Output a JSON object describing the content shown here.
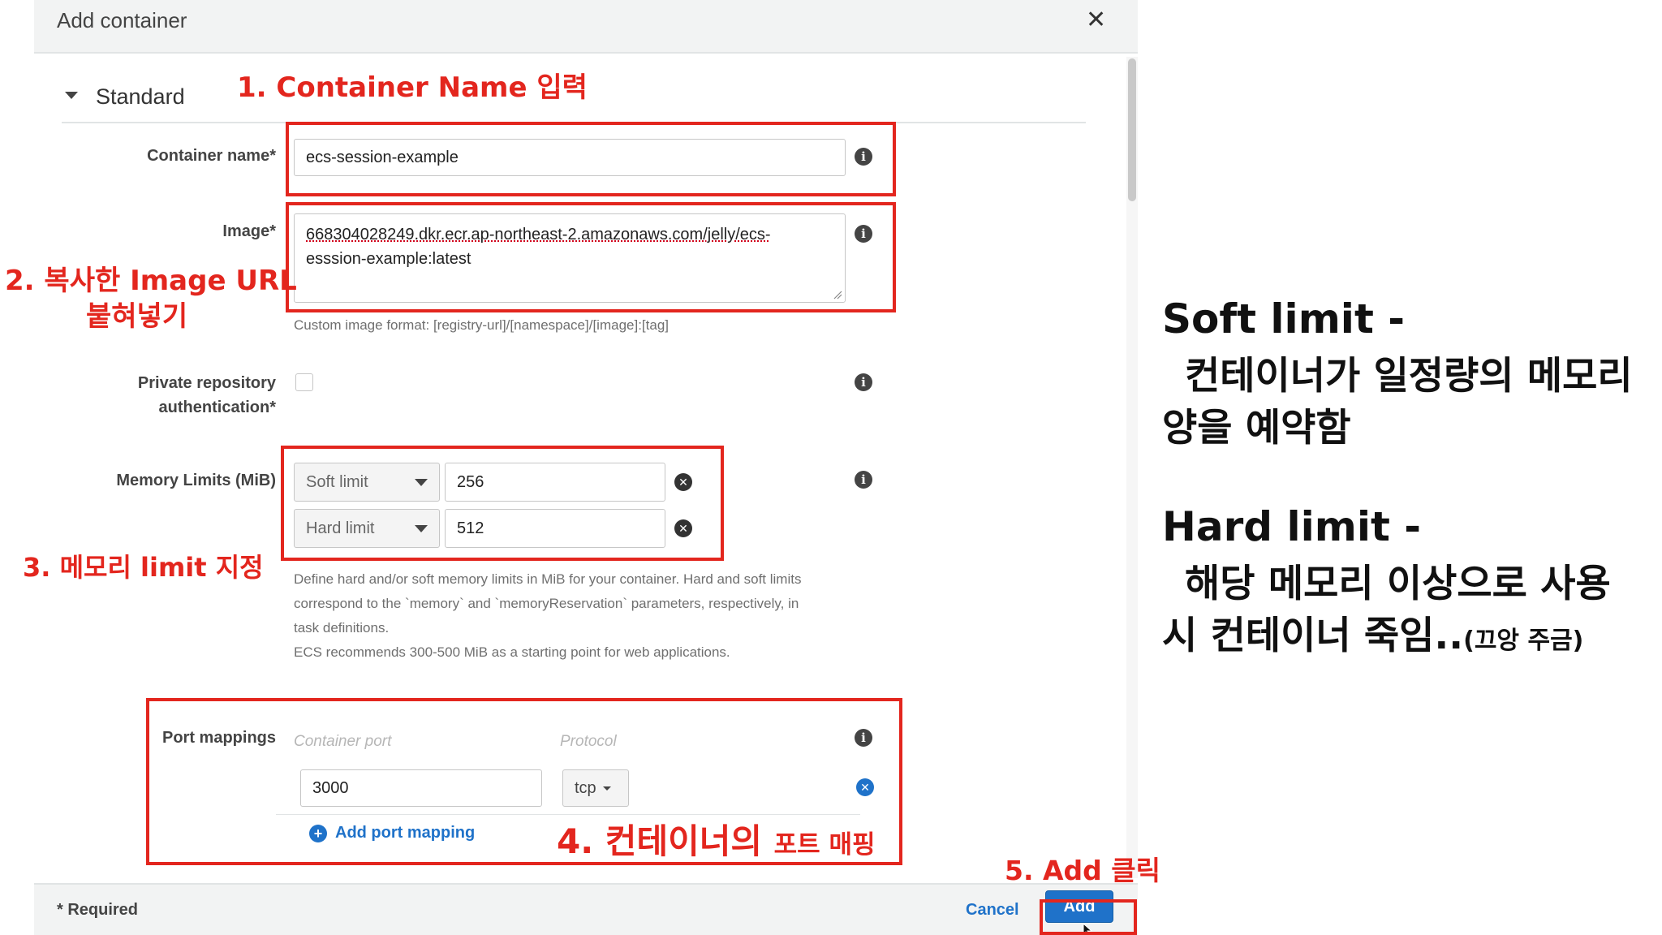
{
  "modal": {
    "title": "Add container",
    "section": "Standard",
    "container_name": {
      "label": "Container name*",
      "value": "ecs-session-example"
    },
    "image": {
      "label": "Image*",
      "value_line1": "668304028249.dkr.ecr.ap-northeast-2.amazonaws.com/jelly/ecs-",
      "value_line2": "esssion-example:latest",
      "hint": "Custom image format: [registry-url]/[namespace]/[image]:[tag]"
    },
    "private_repo": {
      "label_line1": "Private repository",
      "label_line2": "authentication*"
    },
    "memory": {
      "label": "Memory Limits (MiB)",
      "soft_label": "Soft limit",
      "soft_value": "256",
      "hard_label": "Hard limit",
      "hard_value": "512",
      "hint_line1": "Define hard and/or soft memory limits in MiB for your container. Hard and soft limits",
      "hint_line2": "correspond to the `memory` and `memoryReservation` parameters, respectively, in",
      "hint_line3": "task definitions.",
      "hint_line4": "ECS recommends 300-500 MiB as a starting point for web applications."
    },
    "ports": {
      "label": "Port mappings",
      "container_port_header": "Container port",
      "protocol_header": "Protocol",
      "container_port_value": "3000",
      "protocol_value": "tcp",
      "add_link": "Add port mapping"
    },
    "footer": {
      "required": "* Required",
      "cancel": "Cancel",
      "add": "Add"
    }
  },
  "annotations": {
    "step1": "1. Container Name 입력",
    "step2_line1": "2. 복사한 Image URL",
    "step2_line2": "붙혀넣기",
    "step3": "3. 메모리 limit 지정",
    "step4_big": "4. 컨테이너의",
    "step4_small": "포트 매핑",
    "step5": "5. Add 클릭"
  },
  "side_notes": {
    "soft_title": "Soft limit -",
    "soft_line1": "컨테이너가 일정량의 메모리",
    "soft_line2": "양을 예약함",
    "hard_title": "Hard limit -",
    "hard_line1": "해당 메모리 이상으로 사용",
    "hard_line2": "시 컨테이너 죽임..",
    "hard_small": "(끄앙 주금)"
  },
  "colors": {
    "annotation_red": "#e3261e",
    "aws_blue": "#1f72c9"
  },
  "icons": [
    "close-icon",
    "chevron-down-icon",
    "info-icon",
    "remove-circle-icon",
    "add-circle-icon",
    "pointer-cursor-icon"
  ]
}
